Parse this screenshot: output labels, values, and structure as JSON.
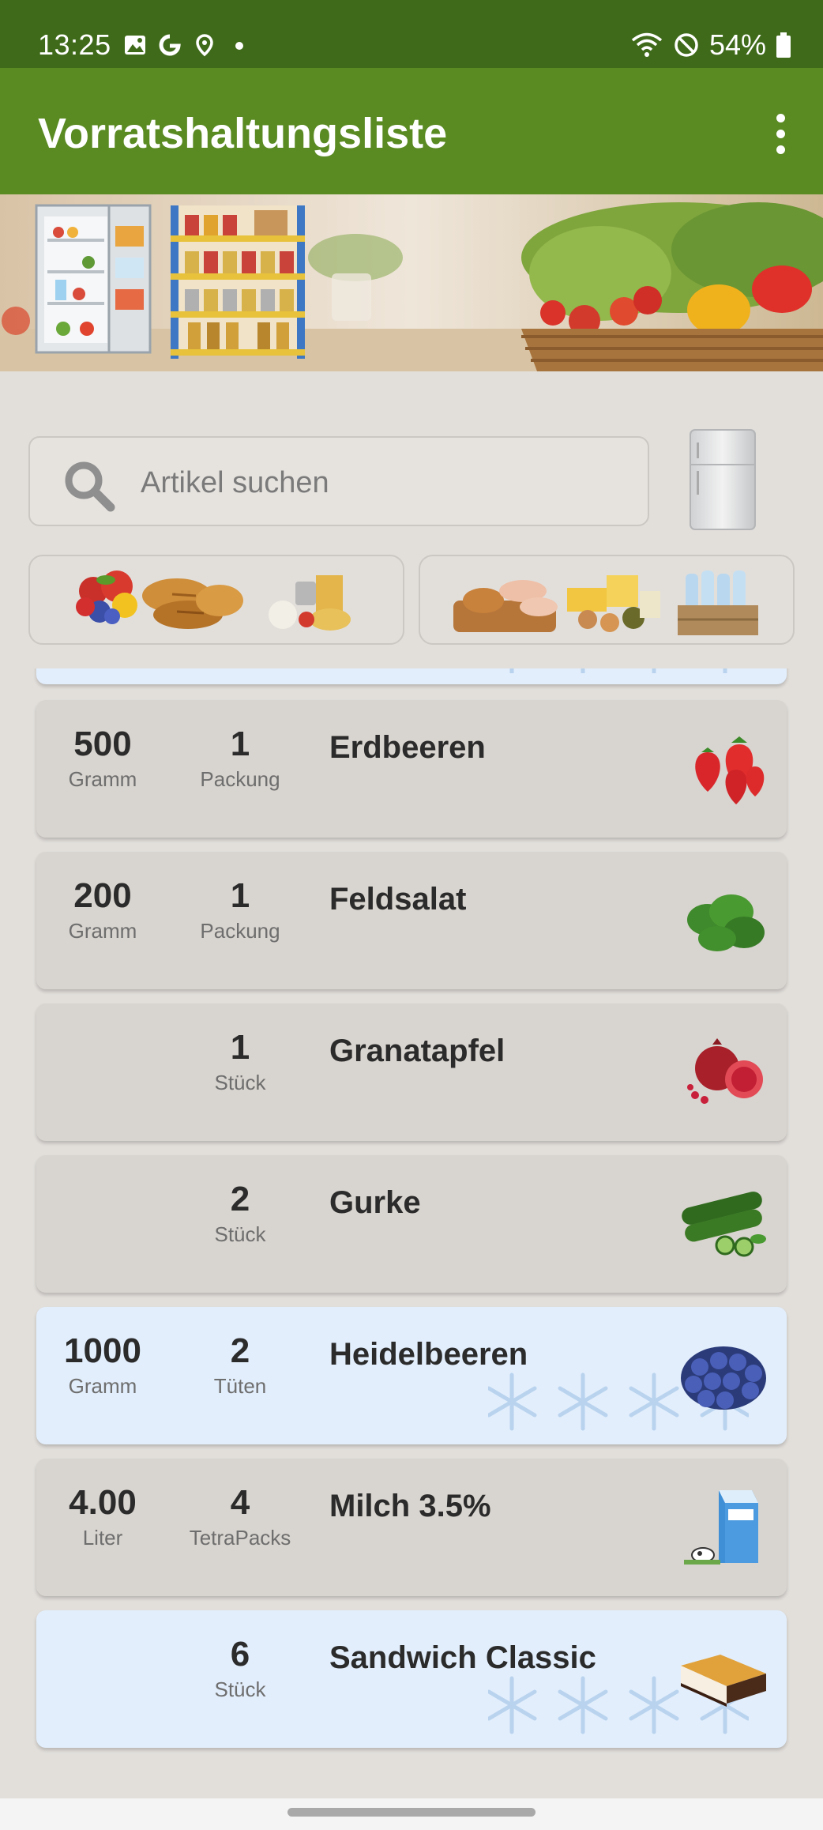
{
  "status_bar": {
    "time": "13:25",
    "battery": "54%"
  },
  "app_bar": {
    "title": "Vorratshaltungsliste"
  },
  "search": {
    "placeholder": "Artikel suchen"
  },
  "items": [
    {
      "qty1": "500",
      "unit1": "Gramm",
      "qty2": "1",
      "unit2": "Packung",
      "name": "Erdbeeren",
      "frozen": false,
      "icon": "strawberry-icon"
    },
    {
      "qty1": "200",
      "unit1": "Gramm",
      "qty2": "1",
      "unit2": "Packung",
      "name": "Feldsalat",
      "frozen": false,
      "icon": "lettuce-icon"
    },
    {
      "qty1": "",
      "unit1": "",
      "qty2": "1",
      "unit2": "Stück",
      "name": "Granatapfel",
      "frozen": false,
      "icon": "pomegranate-icon"
    },
    {
      "qty1": "",
      "unit1": "",
      "qty2": "2",
      "unit2": "Stück",
      "name": "Gurke",
      "frozen": false,
      "icon": "cucumber-icon"
    },
    {
      "qty1": "1000",
      "unit1": "Gramm",
      "qty2": "2",
      "unit2": "Tüten",
      "name": "Heidelbeeren",
      "frozen": true,
      "icon": "blueberry-icon"
    },
    {
      "qty1": "4.00",
      "unit1": "Liter",
      "qty2": "4",
      "unit2": "TetraPacks",
      "name": "Milch 3.5%",
      "frozen": false,
      "icon": "milk-carton-icon"
    },
    {
      "qty1": "",
      "unit1": "",
      "qty2": "6",
      "unit2": "Stück",
      "name": "Sandwich Classic",
      "frozen": true,
      "icon": "ice-cream-sandwich-icon"
    }
  ],
  "colors": {
    "status_bar": "#3f6a1a",
    "app_bar": "#5a8a22",
    "background": "#e2dfdb",
    "card": "#d8d4cf",
    "frozen_card": "#e2eefc"
  }
}
